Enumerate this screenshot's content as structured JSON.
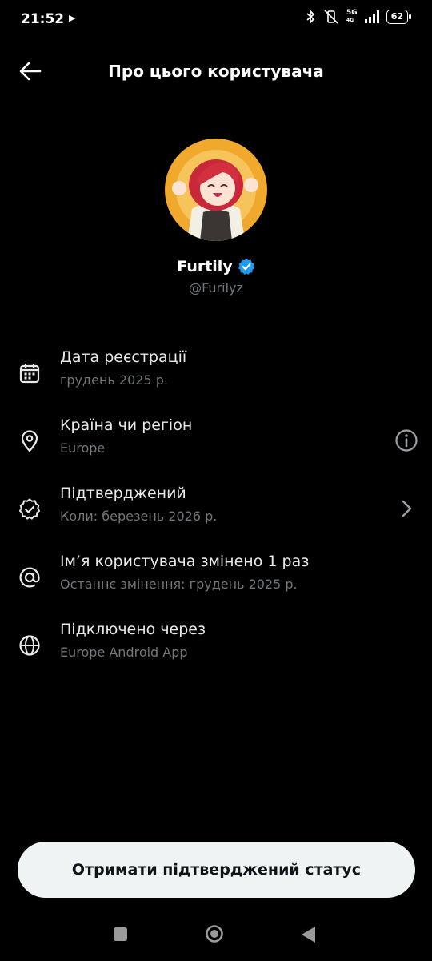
{
  "status_bar": {
    "time": "21:52",
    "network": "5G",
    "network_sub": "4G",
    "battery": "62"
  },
  "header": {
    "title": "Про цього користувача"
  },
  "profile": {
    "name": "Furtily",
    "handle": "@Furilyz",
    "verified_color": "#1d9bf0"
  },
  "details": [
    {
      "icon": "calendar-icon",
      "label": "Дата реєстрації",
      "sub": "грудень 2025 р."
    },
    {
      "icon": "location-pin-icon",
      "label": "Країна чи регіон",
      "sub": "Europe",
      "right_icon": "info-icon"
    },
    {
      "icon": "verified-badge-icon",
      "label": "Підтверджений",
      "sub": "Коли: березень 2026 р.",
      "right_icon": "chevron-right-icon"
    },
    {
      "icon": "at-sign-icon",
      "label": "Ім’я користувача змінено 1 раз",
      "sub": "Останнє змінення: грудень 2025 р."
    },
    {
      "icon": "globe-icon",
      "label": "Підключено через",
      "sub": "Europe Android App"
    }
  ],
  "cta": {
    "label": "Отримати підтверджений статус"
  }
}
